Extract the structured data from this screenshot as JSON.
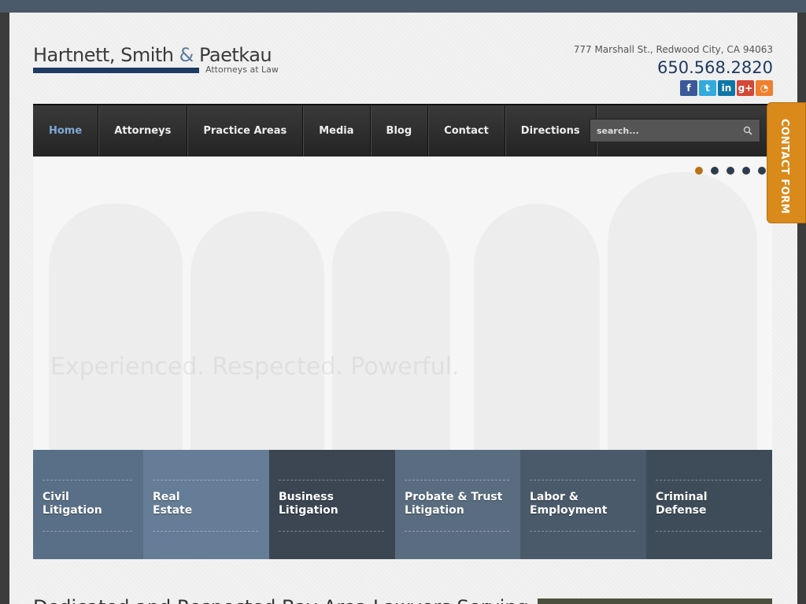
{
  "brand": {
    "name_part1": "Hartnett",
    "name_part2": ", Smith ",
    "name_amp": "&",
    "name_part3": " Paetkau",
    "tagline": "Attorneys at Law"
  },
  "header": {
    "address": "777 Marshall St., Redwood City, CA 94063",
    "phone": "650.568.2820",
    "social": [
      {
        "name": "facebook-icon",
        "glyph": "f",
        "color": "#3b5998"
      },
      {
        "name": "twitter-icon",
        "glyph": "t",
        "color": "#33aadd"
      },
      {
        "name": "linkedin-icon",
        "glyph": "in",
        "color": "#0e76a8"
      },
      {
        "name": "googleplus-icon",
        "glyph": "g+",
        "color": "#d34836"
      },
      {
        "name": "rss-icon",
        "glyph": "◔",
        "color": "#ee802f"
      }
    ]
  },
  "nav": {
    "items": [
      "Home",
      "Attorneys",
      "Practice Areas",
      "Media",
      "Blog",
      "Contact",
      "Directions"
    ],
    "active": "Home",
    "search_placeholder": "search..."
  },
  "contact_tab": "CONTACT FORM",
  "hero": {
    "text": "Experienced. Respected. Powerful.",
    "slide_count": 5,
    "active_slide": 1
  },
  "practice_areas": [
    {
      "line1": "Civil",
      "line2": "Litigation",
      "color": "#586f87"
    },
    {
      "line1": "Real",
      "line2": "Estate",
      "color": "#657d96"
    },
    {
      "line1": "Business",
      "line2": "Litigation",
      "color": "#3b4652"
    },
    {
      "line1": "Probate & Trust",
      "line2": "Litigation",
      "color": "#5a6d80"
    },
    {
      "line1": "Labor &",
      "line2": "Employment",
      "color": "#4a5a6b"
    },
    {
      "line1": "Criminal",
      "line2": "Defense",
      "color": "#3e4c5a"
    }
  ],
  "bottom": {
    "heading": "Dedicated and Respected Bay Area Lawyers Serving"
  }
}
